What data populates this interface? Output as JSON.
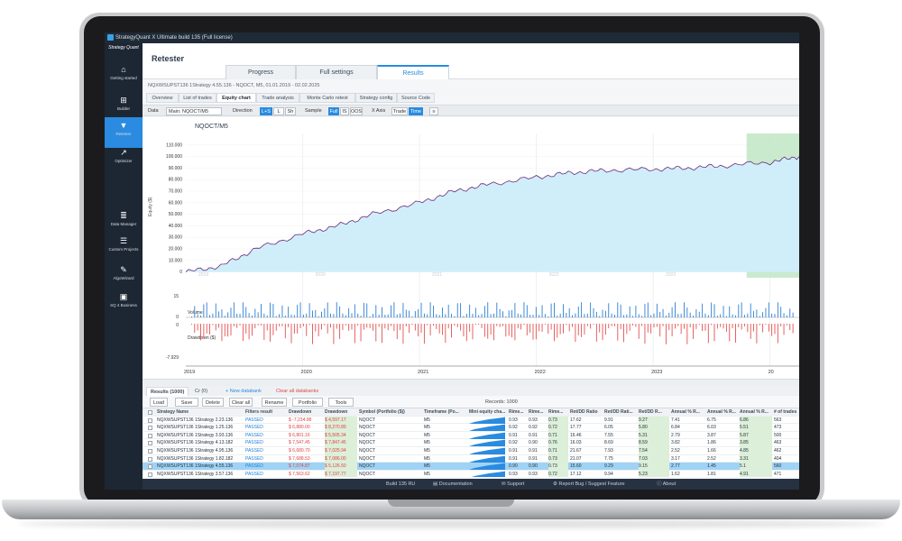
{
  "app": {
    "title": "StrategyQuant X Ultimate build 135 (Full license)",
    "brand": "Strategy Quant"
  },
  "sidebar": {
    "items": [
      {
        "label": "Getting started",
        "icon": "home-icon"
      },
      {
        "label": "Builder",
        "icon": "plus-box-icon"
      },
      {
        "label": "Retester",
        "icon": "filter-icon"
      },
      {
        "label": "Optimizer",
        "icon": "chart-line-icon"
      },
      {
        "label": "Data Manager",
        "icon": "database-icon"
      },
      {
        "label": "Custom Projects",
        "icon": "list-icon"
      },
      {
        "label": "AlgoWizard",
        "icon": "wand-icon"
      },
      {
        "label": "SQ 4 Business",
        "icon": "briefcase-icon"
      }
    ]
  },
  "header": {
    "title": "Retester",
    "tabs": [
      "Progress",
      "Full settings",
      "Results"
    ]
  },
  "strategy_line": "NQXWSUPST136 1Strategy 4.55.136 - NQOCT, M5, 01.01.2019 - 02.02.2025",
  "subtabs": [
    "Overview",
    "List of trades",
    "Equity chart",
    "Trade analysis",
    "Monte Carlo retest",
    "Strategy config",
    "Source Code"
  ],
  "toolbar": {
    "data_label": "Data",
    "data_value": "Main: NQOCT/M5",
    "direction_label": "Direction",
    "direction": [
      "L+S",
      "L",
      "Sh"
    ],
    "sample_label": "Sample",
    "sample": [
      "Full",
      "IS",
      "OOS"
    ],
    "xaxis_label": "X Axis",
    "xaxis": [
      "Trade",
      "Time"
    ],
    "menu_icon": "hamburger-icon"
  },
  "chart_data": {
    "type": "area",
    "title": "NQOCT/M5",
    "ylabel": "Equity ($)",
    "y_ticks": [
      "110.000",
      "100.000",
      "90.000",
      "80.000",
      "70.000",
      "60.000",
      "50.000",
      "40.000",
      "30.000",
      "20.000",
      "10.000",
      "0"
    ],
    "ylim": [
      -5000,
      120000
    ],
    "x_labels_top": [
      "2019",
      "2020",
      "2021",
      "2022",
      "2023"
    ],
    "x_labels_bottom": [
      "2019",
      "2020",
      "2021",
      "2022",
      "2023",
      "20"
    ],
    "series": [
      {
        "name": "Equity",
        "x": [
          2019.0,
          2019.3,
          2019.6,
          2020.0,
          2020.3,
          2020.6,
          2021.0,
          2021.3,
          2021.6,
          2022.0,
          2022.3,
          2022.6,
          2023.0,
          2023.3,
          2023.6,
          2024.0,
          2024.25
        ],
        "values": [
          0,
          5000,
          20000,
          33000,
          40000,
          50000,
          60000,
          70000,
          76000,
          82000,
          86000,
          88000,
          89000,
          90000,
          92000,
          95000,
          100000
        ]
      }
    ],
    "oos_start": 2023.8,
    "volume_label": "Volume",
    "volume_ticks": [
      "15",
      "0"
    ],
    "drawdown_label": "Drawdown ($)",
    "drawdown_ticks": [
      "0",
      "-7.929"
    ]
  },
  "results": {
    "tabs": [
      "Results (1000)",
      "Cr (0)"
    ],
    "new_databank": "+ New databank",
    "clear_all": "Clear all databanks",
    "buttons": [
      "Load",
      "Save",
      "Delete",
      "Clear all",
      "Rename",
      "Portfolio",
      "Tools"
    ],
    "records": "Records: 1000",
    "columns": [
      "Strategy Name",
      "Filters result",
      "Drawdown",
      "Drawdown",
      "Symbol (Portfolio ($))",
      "Timeframe (Po...",
      "Mini equity cha...",
      "Rime...",
      "Rime...",
      "Rime...",
      "Ret/DD Ratio",
      "Ret/DD Rati...",
      "Ret/DD R...",
      "Annual % R...",
      "Annual % R...",
      "Annual % R...",
      "# of trades"
    ],
    "rows": [
      [
        "NQXWSUPST136 1Strategy 2.23.136",
        "PASSED",
        "$ -7,234.98",
        "$ 4,597.17",
        "NQOCT",
        "M5",
        "0.93",
        "0.93",
        "0.73",
        "17.62",
        "9.91",
        "9.27",
        "7.41",
        "6.75",
        "6.86",
        "563"
      ],
      [
        "NQXWSUPST136 1Strategy 1.25.136",
        "PASSED",
        "$ 6,880.00",
        "$ 8,270.89",
        "NQOCT",
        "M5",
        "0.92",
        "0.92",
        "0.72",
        "17.77",
        "6.05",
        "5.80",
        "6.84",
        "6.03",
        "5.51",
        "473"
      ],
      [
        "NQXWSUPST136 1Strategy 3.93.136",
        "PASSED",
        "$ 6,801.16",
        "$ 5,505.34",
        "NQOCT",
        "M5",
        "0.91",
        "0.91",
        "0.71",
        "16.46",
        "7.55",
        "5.31",
        "2.79",
        "3.87",
        "5.87",
        "500"
      ],
      [
        "NQXWSUPST136 1Strategy 4.13.182",
        "PASSED",
        "$ 7,547.45",
        "$ 7,847.45",
        "NQOCT",
        "M5",
        "0.92",
        "0.90",
        "0.76",
        "16.03",
        "8.69",
        "8.59",
        "3.82",
        "1.86",
        "3.85",
        "463"
      ],
      [
        "NQXWSUPST136 1Strategy 4.95.136",
        "PASSED",
        "$ 6,680.70",
        "$ 7,025.94",
        "NQOCT",
        "M5",
        "0.91",
        "0.91",
        "0.71",
        "21.67",
        "7.93",
        "7.54",
        "2.52",
        "1.66",
        "4.85",
        "462"
      ],
      [
        "NQXWSUPST136 1Strategy 1.82.182",
        "PASSED",
        "$ 7,688.53",
        "$ 7,086.00",
        "NQOCT",
        "M5",
        "0.91",
        "0.91",
        "0.73",
        "21.07",
        "7.75",
        "7.03",
        "3.17",
        "2.52",
        "3.31",
        "404"
      ],
      [
        "NQXWSUPST136 1Strategy 4.55.136",
        "PASSED",
        "$ 7,074.87",
        "$ 5,126.50",
        "NQOCT",
        "M5",
        "0.90",
        "0.90",
        "0.73",
        "15.60",
        "9.29",
        "9.15",
        "2.77",
        "1.45",
        "5.1",
        "560"
      ],
      [
        "NQXWSUPST136 1Strategy 3.57.136",
        "PASSED",
        "$ 7,563.62",
        "$ 7,197.77",
        "NQOCT",
        "M5",
        "0.93",
        "0.93",
        "0.72",
        "17.12",
        "9.94",
        "5.23",
        "1.62",
        "1.81",
        "4.91",
        "471"
      ]
    ]
  },
  "statusbar": {
    "build": "Build 135 RU",
    "documentation": "Documentation",
    "support": "Support",
    "report": "Report Bug / Suggest Feature",
    "about": "About"
  }
}
